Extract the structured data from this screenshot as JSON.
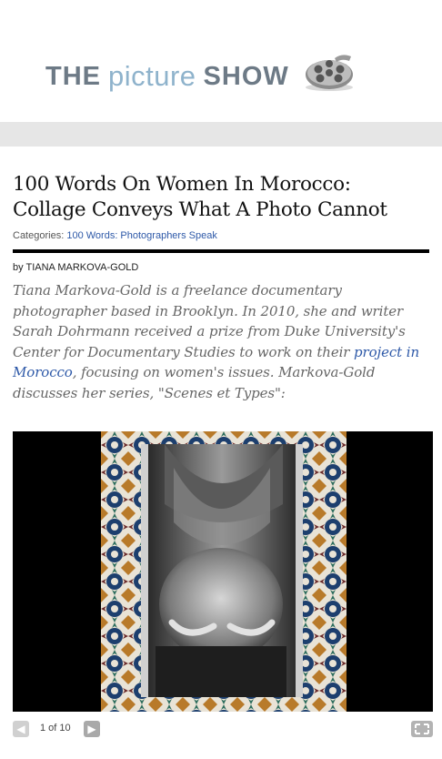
{
  "header": {
    "logo_the": "THE",
    "logo_picture": "picture",
    "logo_show": "SHOW",
    "reel_icon": "film-reel-icon"
  },
  "article": {
    "title": "100 Words On Women In Morocco: Collage Conveys What A Photo Cannot",
    "categories_label": "Categories:",
    "category": "100 Words: Photographers Speak",
    "byline_prefix": "by",
    "author": "TIANA MARKOVA-GOLD",
    "intro_part1": "Tiana Markova-Gold is a freelance documentary photographer based in Brooklyn. In 2010, she and writer Sarah Dohrmann received a prize from Duke University's Center for Documentary Studies to work on their ",
    "intro_link": "project in Morocco",
    "intro_part2": ", focusing on women's issues. Markova-Gold discusses her series, \"Scenes et Types\":"
  },
  "slideshow": {
    "counter": "1 of 10",
    "prev_icon": "chevron-left-icon",
    "next_icon": "chevron-right-icon",
    "fullscreen_icon": "fullscreen-icon"
  },
  "colors": {
    "link": "#2e59a8",
    "logo_gray": "#6d7a86",
    "logo_blue": "#8fb3cc",
    "band": "#e6e6e6"
  }
}
